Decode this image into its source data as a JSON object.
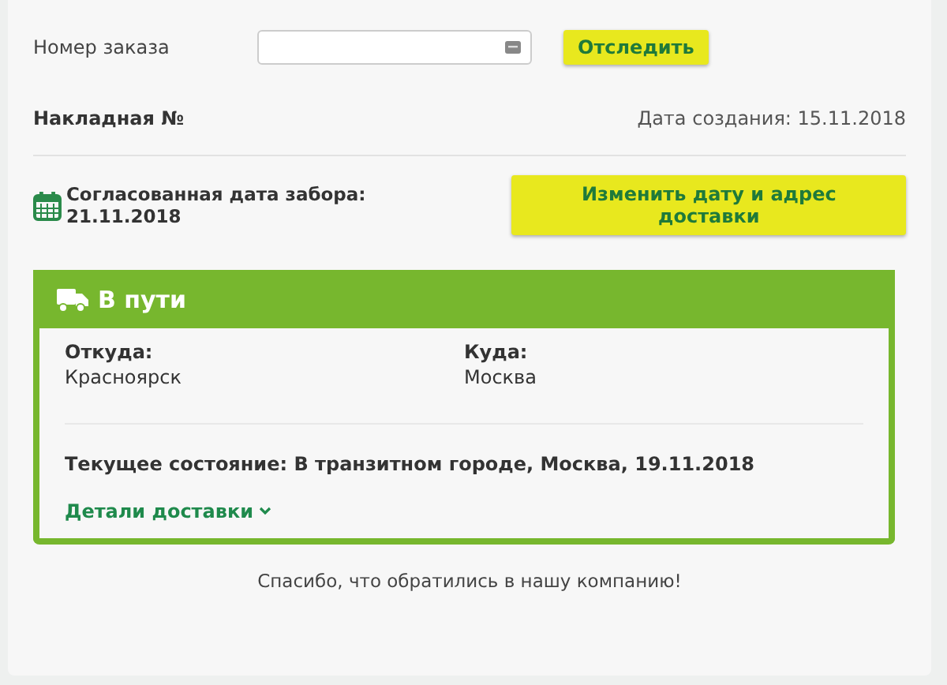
{
  "order": {
    "label": "Номер заказа",
    "button": "Отследить"
  },
  "waybill": {
    "label": "Накладная №",
    "created": "Дата создания: 15.11.2018"
  },
  "pickup": {
    "text": "Согласованная дата забора: 21.11.2018",
    "button": "Изменить дату и адрес доставки"
  },
  "status": {
    "title": "В пути",
    "from": {
      "label": "Откуда:",
      "value": "Красноярск"
    },
    "to": {
      "label": "Куда:",
      "value": "Москва"
    },
    "current": "Текущее состояние: В транзитном городе, Москва, 19.11.2018",
    "details": "Детали доставки"
  },
  "footer": "Спасибо, что обратились в нашу компанию!"
}
